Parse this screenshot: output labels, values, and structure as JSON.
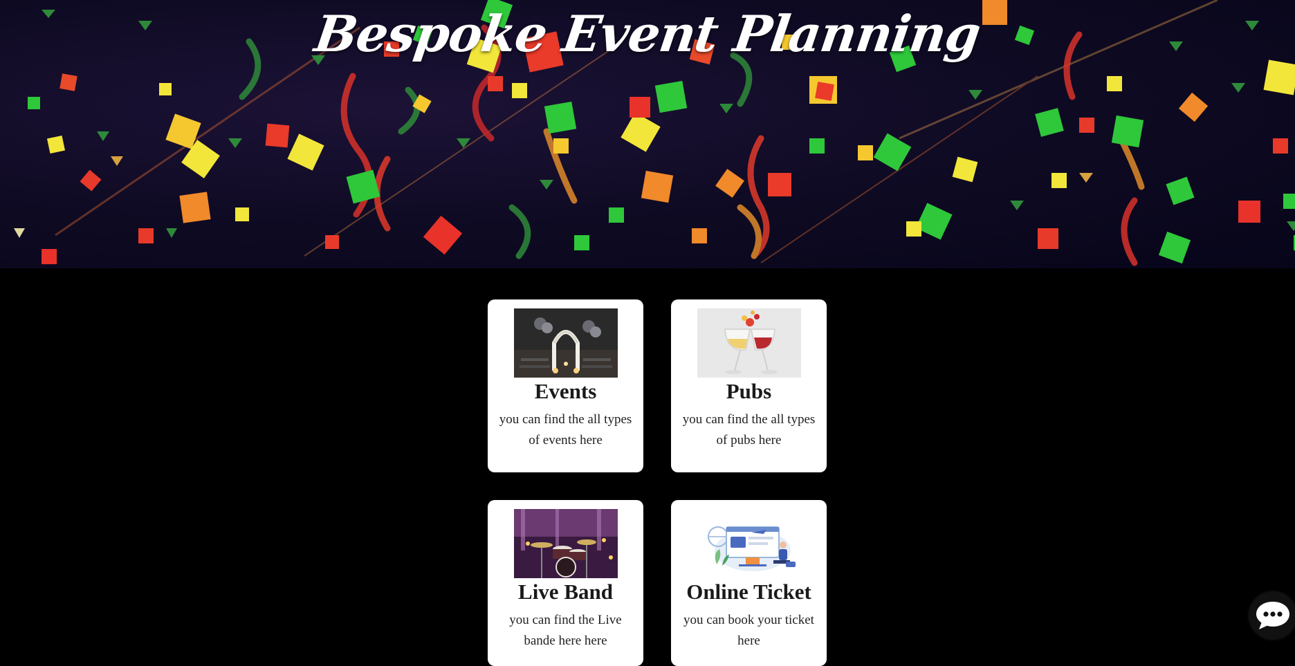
{
  "hero": {
    "title": "Bespoke Event Planning"
  },
  "cards": [
    {
      "title": "Events",
      "description": "you can find the all types of events here",
      "image": "event-arch-photo"
    },
    {
      "title": "Pubs",
      "description": "you can find the all types of pubs here",
      "image": "wine-glasses-toast-photo"
    },
    {
      "title": "Live Band",
      "description": "you can find the Live bande here here",
      "image": "drum-kit-stage-photo"
    },
    {
      "title": "Online Ticket",
      "description": "you can book your ticket here",
      "image": "online-ticket-illustration"
    }
  ],
  "chat": {
    "icon": "chat-bubble-icon"
  },
  "colors": {
    "page_background": "#000000",
    "card_background": "#ffffff",
    "hero_background": "#0e0a22"
  }
}
